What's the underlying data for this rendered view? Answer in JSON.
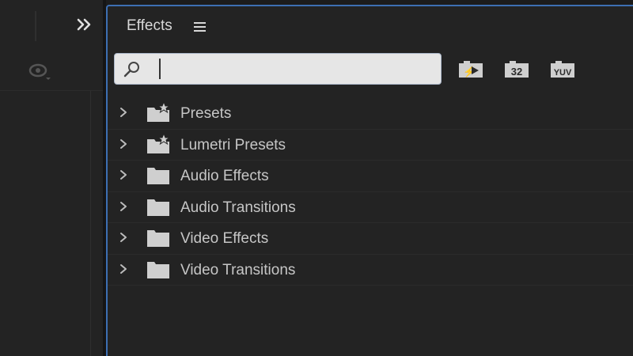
{
  "left_panel": {
    "expand_glyph": "»"
  },
  "effects_panel": {
    "title": "Effects",
    "search": {
      "value": "",
      "placeholder": ""
    },
    "filter_buttons": [
      {
        "label": "",
        "icon": "accelerated-effects-icon"
      },
      {
        "label": "32",
        "icon": "32-bit-color-icon"
      },
      {
        "label": "YUV",
        "icon": "yuv-effects-icon"
      }
    ],
    "tree": [
      {
        "label": "Presets",
        "icon": "star-folder-icon"
      },
      {
        "label": "Lumetri Presets",
        "icon": "star-folder-icon"
      },
      {
        "label": "Audio Effects",
        "icon": "folder-icon"
      },
      {
        "label": "Audio Transitions",
        "icon": "folder-icon"
      },
      {
        "label": "Video Effects",
        "icon": "folder-icon"
      },
      {
        "label": "Video Transitions",
        "icon": "folder-icon"
      }
    ]
  },
  "colors": {
    "background": "#1c1c1c",
    "panel": "#232323",
    "focus_border": "#3d6fb3",
    "text": "#c6c6c6",
    "icon": "#cfcfcf"
  }
}
